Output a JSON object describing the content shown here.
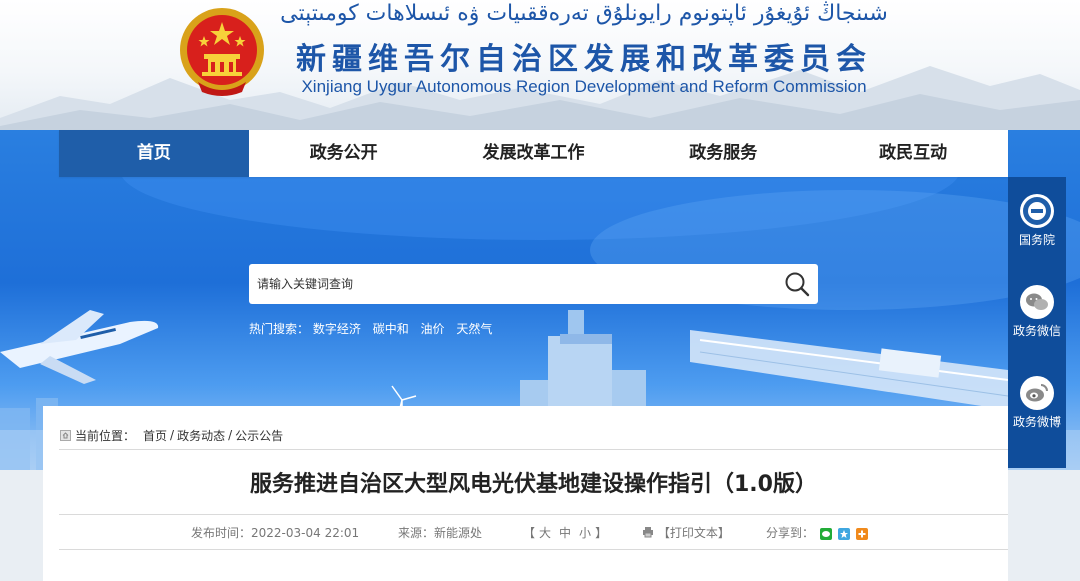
{
  "header": {
    "title_uyghur": "شىنجاڭ ئۇيغۇر ئاپتونوم رايونلۇق تەرەققىيات ۋە ئىسلاھات كومىتېتى",
    "title_zh": "新疆维吾尔自治区发展和改革委员会",
    "title_en": "Xinjiang Uygur Autonomous Region Development and Reform Commission"
  },
  "nav": {
    "items": [
      {
        "label": "首页",
        "active": true
      },
      {
        "label": "政务公开"
      },
      {
        "label": "发展改革工作"
      },
      {
        "label": "政务服务"
      },
      {
        "label": "政民互动"
      }
    ]
  },
  "search": {
    "placeholder": "请输入关键词查询",
    "hot_label": "热门搜索：",
    "hot_keywords": [
      "数字经济",
      "碳中和",
      "油价",
      "天然气"
    ]
  },
  "side": {
    "items": [
      {
        "label": "国务院",
        "icon": "state-council-icon"
      },
      {
        "label": "政务微信",
        "icon": "wechat-icon"
      },
      {
        "label": "政务微博",
        "icon": "weibo-icon"
      }
    ]
  },
  "breadcrumb": {
    "label": "当前位置：",
    "items": [
      "首页",
      "政务动态",
      "公示公告"
    ]
  },
  "article": {
    "title": "服务推进自治区大型风电光伏基地建设操作指引（1.0版）",
    "publish_label": "发布时间：",
    "publish_time": "2022-03-04 22:01",
    "source_label": "来源：",
    "source": "新能源处",
    "font_open": "【",
    "font_sizes": [
      "大",
      "中",
      "小"
    ],
    "font_close": "】",
    "print_label": "【打印文本】",
    "share_label": "分享到："
  },
  "colors": {
    "brand_blue": "#1d56a8",
    "nav_active": "#1f5ea9",
    "side_bg": "#0f4d9b"
  }
}
